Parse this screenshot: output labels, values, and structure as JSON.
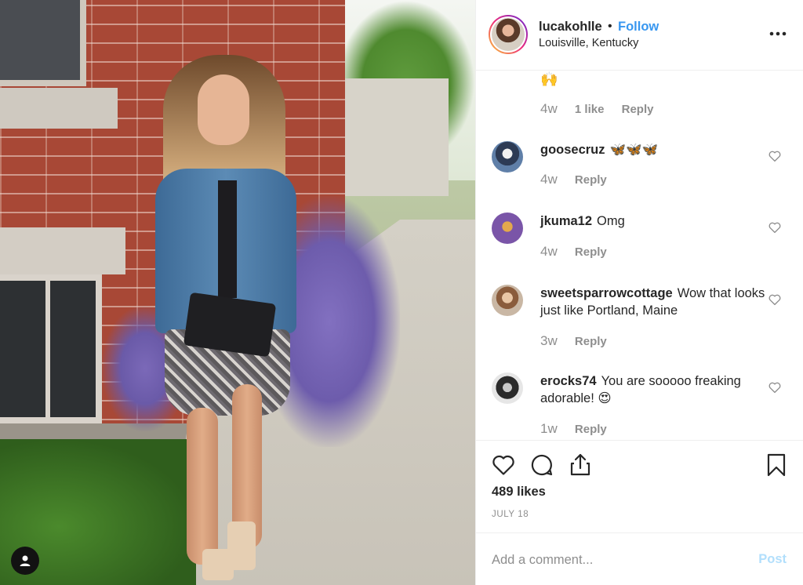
{
  "post": {
    "photo_alt": "Photo of a woman in a denim jacket on a sidewalk",
    "header": {
      "username": "lucakohlle",
      "separator": "•",
      "follow_label": "Follow",
      "location": "Louisville, Kentucky",
      "more_icon": "more-horizontal-icon"
    },
    "first_comment": {
      "emoji": "🙌",
      "time": "4w",
      "likes": "1 like",
      "reply": "Reply"
    },
    "comments": [
      {
        "username": "goosecruz",
        "text": "🦋🦋🦋",
        "time": "4w",
        "reply": "Reply"
      },
      {
        "username": "jkuma12",
        "text": "Omg",
        "time": "4w",
        "reply": "Reply"
      },
      {
        "username": "sweetsparrowcottage",
        "text": "Wow that looks just like Portland, Maine",
        "time": "3w",
        "reply": "Reply"
      },
      {
        "username": "erocks74",
        "text": "You are sooooo freaking adorable! 😍",
        "time": "1w",
        "reply": "Reply"
      }
    ],
    "likes_label": "489 likes",
    "date_label": "JULY 18",
    "comment_placeholder": "Add a comment...",
    "post_label": "Post"
  },
  "colors": {
    "link_blue": "#3897f0",
    "post_disabled": "#b2dffc",
    "muted": "#8e8e8e",
    "text": "#262626"
  }
}
